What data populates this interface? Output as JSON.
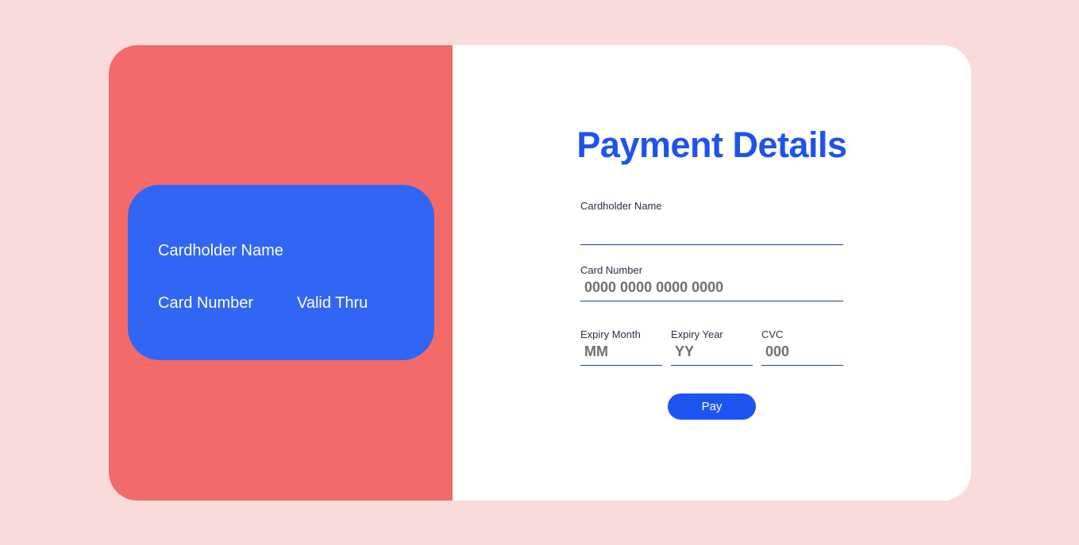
{
  "colors": {
    "page_background": "#fadbdb",
    "left_panel": "#f36b68",
    "card": "#3066f3",
    "title": "#1f53ea",
    "button": "#1c55f2"
  },
  "card_preview": {
    "cardholder_name": "Cardholder Name",
    "card_number": "Card Number",
    "valid_thru": "Valid Thru"
  },
  "form": {
    "title": "Payment Details",
    "cardholder_name": {
      "label": "Cardholder Name",
      "value": "",
      "placeholder": ""
    },
    "card_number": {
      "label": "Card Number",
      "value": "",
      "placeholder": "0000 0000 0000 0000"
    },
    "expiry_month": {
      "label": "Expiry Month",
      "value": "",
      "placeholder": "MM"
    },
    "expiry_year": {
      "label": "Expiry Year",
      "value": "",
      "placeholder": "YY"
    },
    "cvc": {
      "label": "CVC",
      "value": "",
      "placeholder": "000"
    },
    "pay_label": "Pay"
  }
}
